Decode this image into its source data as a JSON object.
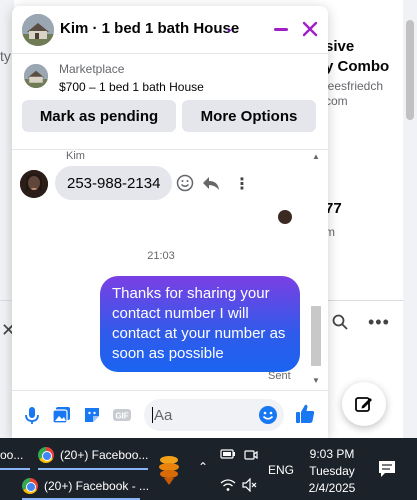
{
  "background": {
    "left_text": "ty",
    "right_title_1": "sive",
    "right_title_2": "y Combo",
    "right_sub_1": "jeesfriedch",
    "right_sub_2": "com",
    "right_price": "77",
    "right_meta": "m"
  },
  "chat": {
    "title": "Kim · 1 bed 1 bath House",
    "listing": {
      "label": "Marketplace",
      "price": "$700 – 1 bed 1 bath House",
      "mark_pending": "Mark as pending",
      "more_options": "More Options"
    },
    "messages": {
      "sender": "Kim",
      "incoming_text": "253-988-2134",
      "timestamp": "21:03",
      "outgoing_text": "Thanks for sharing your contact number I will contact at your number as soon as possible",
      "status": "Sent"
    },
    "composer": {
      "placeholder": "Aa",
      "gif_label": "GIF"
    }
  },
  "taskbar": {
    "item1": "oo...",
    "item2": "(20+) Faceboo...",
    "item3": "(20+) Facebook - ...",
    "lang": "ENG",
    "time": "9:03 PM",
    "day": "Tuesday",
    "date": "2/4/2025"
  },
  "colors": {
    "accent": "#a020c8",
    "bubble_out_start": "#7b3fe4",
    "bubble_out_end": "#1b64f2",
    "like": "#1877f2"
  }
}
